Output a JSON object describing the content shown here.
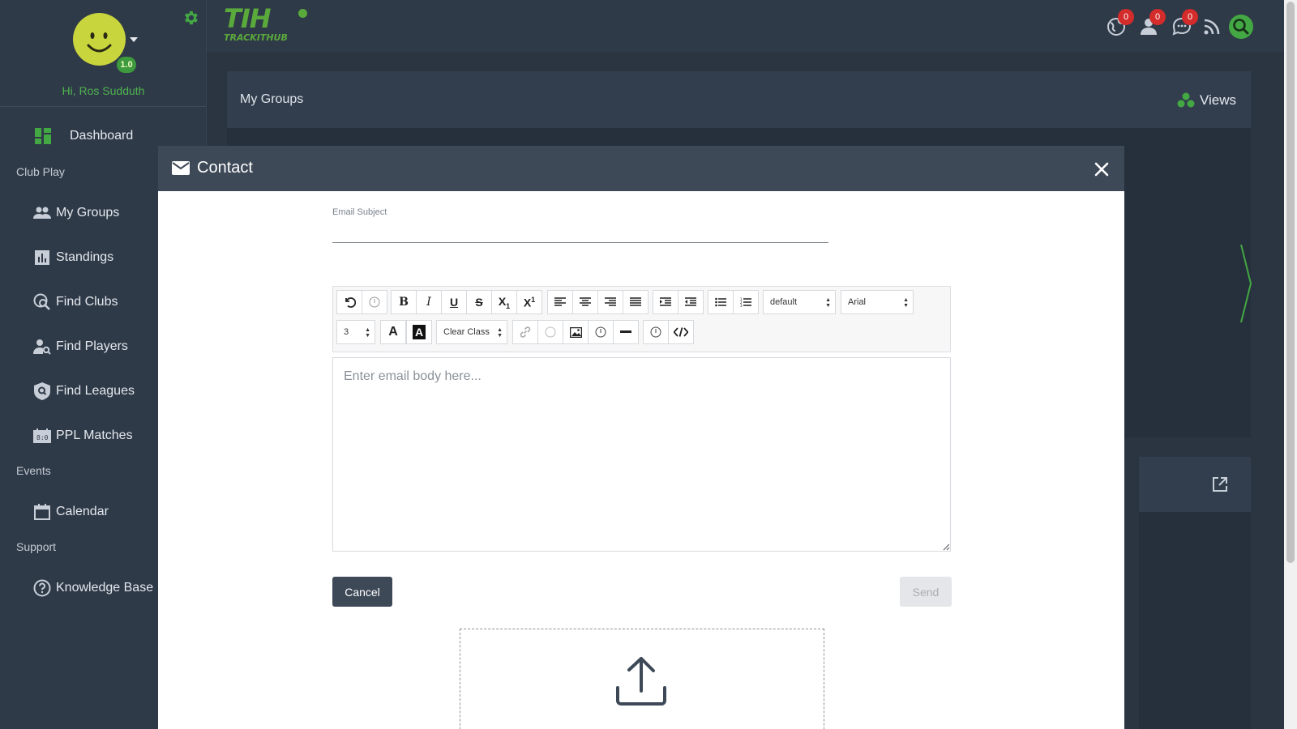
{
  "user": {
    "greeting": "Hi, Ros Sudduth",
    "level": "1.0",
    "avatar_color": "#c9d53d"
  },
  "brand": {
    "logo_text": "TIH",
    "logo_subtext": "TRACKITHUB",
    "accent": "#4fb34f"
  },
  "sidebar": {
    "dashboard": "Dashboard",
    "sections": [
      "Club Play",
      "Events",
      "Support"
    ],
    "items": [
      {
        "label": "My Groups",
        "icon": "groups-icon"
      },
      {
        "label": "Standings",
        "icon": "bar-chart-icon"
      },
      {
        "label": "Find Clubs",
        "icon": "find-clubs-icon"
      },
      {
        "label": "Find Players",
        "icon": "find-players-icon"
      },
      {
        "label": "Find Leagues",
        "icon": "shield-search-icon"
      },
      {
        "label": "PPL Matches",
        "icon": "scoreboard-icon"
      },
      {
        "label": "Calendar",
        "icon": "calendar-icon"
      },
      {
        "label": "Knowledge Base",
        "icon": "help-circle-icon"
      }
    ]
  },
  "topbar": {
    "notifications": [
      {
        "icon": "globe-icon",
        "count": "0"
      },
      {
        "icon": "user-icon",
        "count": "0"
      },
      {
        "icon": "chat-icon",
        "count": "0"
      }
    ]
  },
  "background": {
    "panel_title": "My Groups",
    "views_label": "Views"
  },
  "modal": {
    "title": "Contact",
    "subject_label": "Email Subject",
    "subject_value": "",
    "body_placeholder": "Enter email body here...",
    "cancel_label": "Cancel",
    "send_label": "Send"
  },
  "toolbar": {
    "style_select": "default",
    "font_select": "Arial",
    "size_select": "3",
    "class_select": "Clear Class"
  }
}
